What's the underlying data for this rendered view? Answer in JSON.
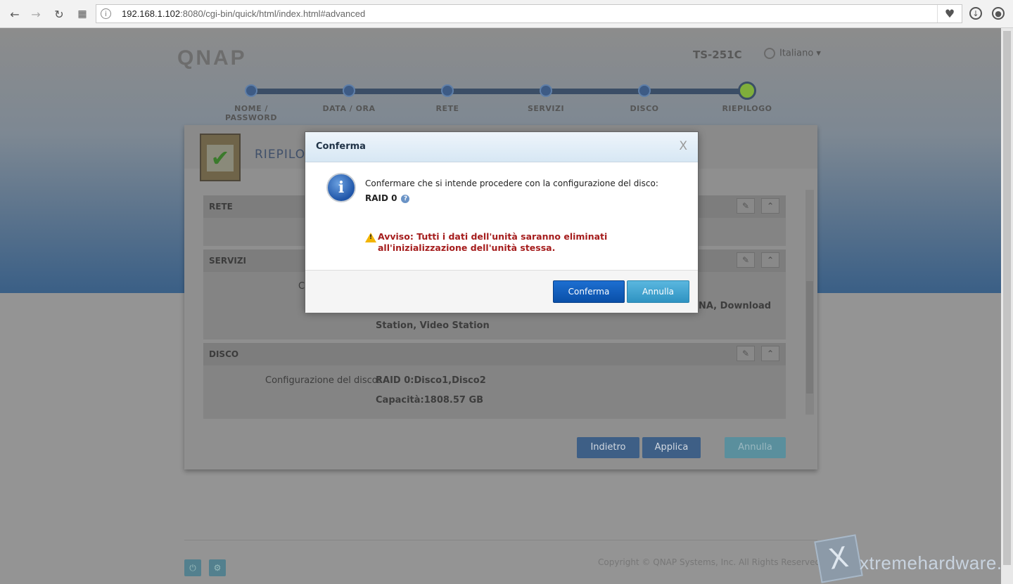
{
  "browser": {
    "url_host": "192.168.1.102",
    "url_rest": ":8080/cgi-bin/quick/html/index.html#advanced",
    "icons": [
      "back-icon",
      "forward-icon",
      "reload-icon",
      "apps-icon",
      "info-icon",
      "heart-icon",
      "download-icon",
      "account-icon"
    ]
  },
  "header": {
    "logo": "QNAP",
    "model": "TS-251C",
    "language": "Italiano"
  },
  "steps": [
    {
      "label": "NOME / PASSWORD"
    },
    {
      "label": "DATA / ORA"
    },
    {
      "label": "RETE"
    },
    {
      "label": "SERVIZI"
    },
    {
      "label": "DISCO"
    },
    {
      "label": "RIEPILOGO"
    }
  ],
  "panel": {
    "title": "RIEPILO",
    "sections": {
      "rete": {
        "title": "RETE"
      },
      "servizi": {
        "title": "SERVIZI",
        "value_line1": "NA, Download",
        "value_line2": "Station, Video Station",
        "key_fragment": "C"
      },
      "disco": {
        "title": "DISCO",
        "key": "Configurazione del disco:",
        "values": [
          "RAID 0:Disco1,Disco2",
          "Capacità:1808.57 GB"
        ]
      }
    },
    "buttons": {
      "back": "Indietro",
      "apply": "Applica",
      "cancel": "Annulla"
    }
  },
  "footer": {
    "copyright": "Copyright © QNAP Systems, Inc. All Rights Reserved",
    "watermark": "xtremehardware.com"
  },
  "modal": {
    "title": "Conferma",
    "close": "X",
    "message": "Confermare che si intende procedere con la configurazione del disco:",
    "raid": "RAID 0",
    "warning_line1": "Avviso: Tutti i dati dell'unità saranno eliminati",
    "warning_line2": "all'inizializzazione dell'unità stessa.",
    "confirm_label": "Conferma",
    "cancel_label": "Annulla"
  },
  "colors": {
    "confirm_button": "#0b57b8",
    "cancel_button": "#3fa3cf",
    "warning_text": "#a51d1d",
    "step_active": "#7fae3b"
  }
}
